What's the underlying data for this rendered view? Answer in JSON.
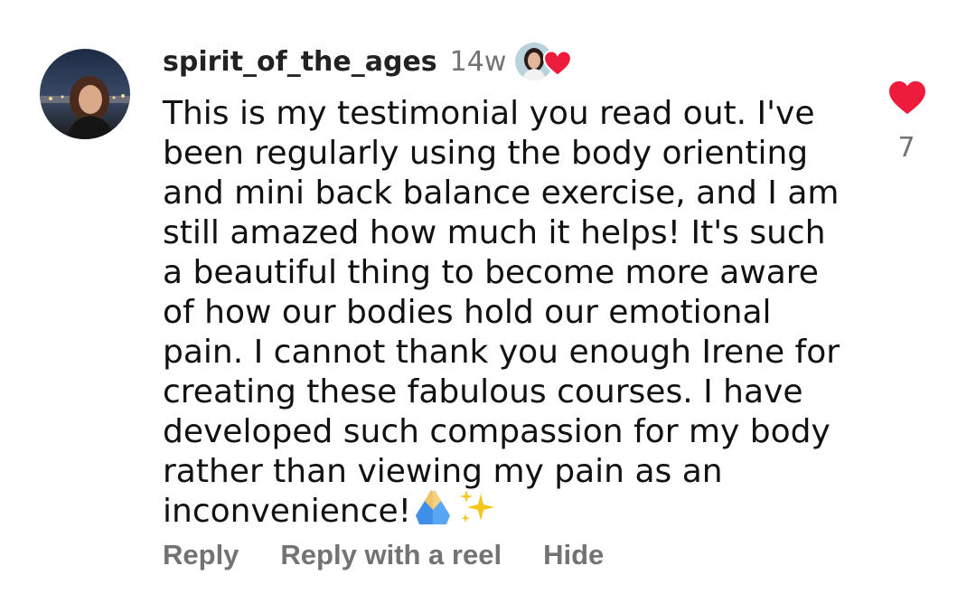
{
  "comment": {
    "username": "spirit_of_the_ages",
    "timestamp": "14w",
    "text": "This is my testimonial you read out. I've\nbeen regularly using the body orienting\nand mini back balance exercise, and I am\nstill amazed how much it helps! It's such\na beautiful thing to become more aware\nof how our bodies hold our emotional\npain. I cannot thank you enough Irene for\ncreating these fabulous courses. I have\ndeveloped such compassion for my body\nrather than viewing my pain as an\ninconvenience!",
    "emojis": [
      "praying-hands-emoji",
      "sparkles-emoji"
    ],
    "like_count": "7",
    "liked": true,
    "creator_liked": true
  },
  "actions": {
    "reply": "Reply",
    "reply_with_reel": "Reply with a reel",
    "hide": "Hide"
  },
  "colors": {
    "heart": "#ed1c3c",
    "secondary_text": "#737373",
    "primary_text": "#111111",
    "emoji_blue": "#3d8fe8",
    "emoji_gold": "#f5c518"
  },
  "icons": {
    "avatar": "user-avatar-photo",
    "creator_avatar": "creator-avatar-photo",
    "creator_like": "heart-icon",
    "like_button": "heart-filled-icon"
  }
}
